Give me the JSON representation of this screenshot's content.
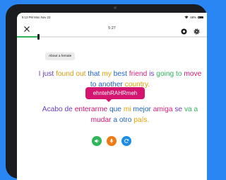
{
  "status_bar": {
    "time_date": "9:13 PM  Mon Nov 23",
    "battery": "68%"
  },
  "toolbar": {
    "timer": "5:27"
  },
  "progress": {
    "fraction": 0.11
  },
  "topic": {
    "label": "About a female"
  },
  "sentences": {
    "english": [
      {
        "text": "I just",
        "color": "#6a3fc4"
      },
      {
        "text": " ",
        "color": "#000000"
      },
      {
        "text": "found out",
        "color": "#d99a12"
      },
      {
        "text": " ",
        "color": "#000000"
      },
      {
        "text": "that",
        "color": "#1f63c9"
      },
      {
        "text": " ",
        "color": "#000000"
      },
      {
        "text": "my",
        "color": "#e0a400"
      },
      {
        "text": " ",
        "color": "#000000"
      },
      {
        "text": "best",
        "color": "#1f63c9"
      },
      {
        "text": " ",
        "color": "#000000"
      },
      {
        "text": "friend",
        "color": "#e0237a"
      },
      {
        "text": " ",
        "color": "#000000"
      },
      {
        "text": "is",
        "color": "#6a3fc4"
      },
      {
        "text": " ",
        "color": "#000000"
      },
      {
        "text": "going to",
        "color": "#2fb55a"
      },
      {
        "text": " ",
        "color": "#000000"
      },
      {
        "text": "move",
        "color": "#d4146f"
      },
      {
        "text": " ",
        "color": "#000000"
      },
      {
        "text": "to another",
        "color": "#1f63c9"
      },
      {
        "text": " ",
        "color": "#000000"
      },
      {
        "text": "country.",
        "color": "#e0a400"
      }
    ],
    "spanish": [
      {
        "text": "Acabo de",
        "color": "#6a3fc4"
      },
      {
        "text": " ",
        "color": "#000000"
      },
      {
        "text": "enterarme",
        "color": "#d4146f"
      },
      {
        "text": " ",
        "color": "#000000"
      },
      {
        "text": "que",
        "color": "#1f63c9"
      },
      {
        "text": " ",
        "color": "#000000"
      },
      {
        "text": "mi",
        "color": "#e0a400"
      },
      {
        "text": " ",
        "color": "#000000"
      },
      {
        "text": "mejor",
        "color": "#1f63c9"
      },
      {
        "text": " ",
        "color": "#000000"
      },
      {
        "text": "amiga",
        "color": "#e0237a"
      },
      {
        "text": " ",
        "color": "#000000"
      },
      {
        "text": "se",
        "color": "#6a3fc4"
      },
      {
        "text": " ",
        "color": "#000000"
      },
      {
        "text": "va a",
        "color": "#2fb55a"
      },
      {
        "text": " ",
        "color": "#000000"
      },
      {
        "text": "mudar",
        "color": "#d4146f"
      },
      {
        "text": " ",
        "color": "#000000"
      },
      {
        "text": "a otro",
        "color": "#1f63c9"
      },
      {
        "text": " ",
        "color": "#000000"
      },
      {
        "text": "país.",
        "color": "#e0a400"
      }
    ]
  },
  "tooltip": {
    "text": "ehntehRAHRmeh"
  },
  "controls": {
    "play_color": "#2fb55a",
    "mic_color": "#f07a14",
    "repeat_color": "#1f8ce6"
  },
  "colors": {
    "accent_green": "#2fb55a",
    "tooltip_bg": "#d4146f",
    "background": "#2a86f2"
  }
}
